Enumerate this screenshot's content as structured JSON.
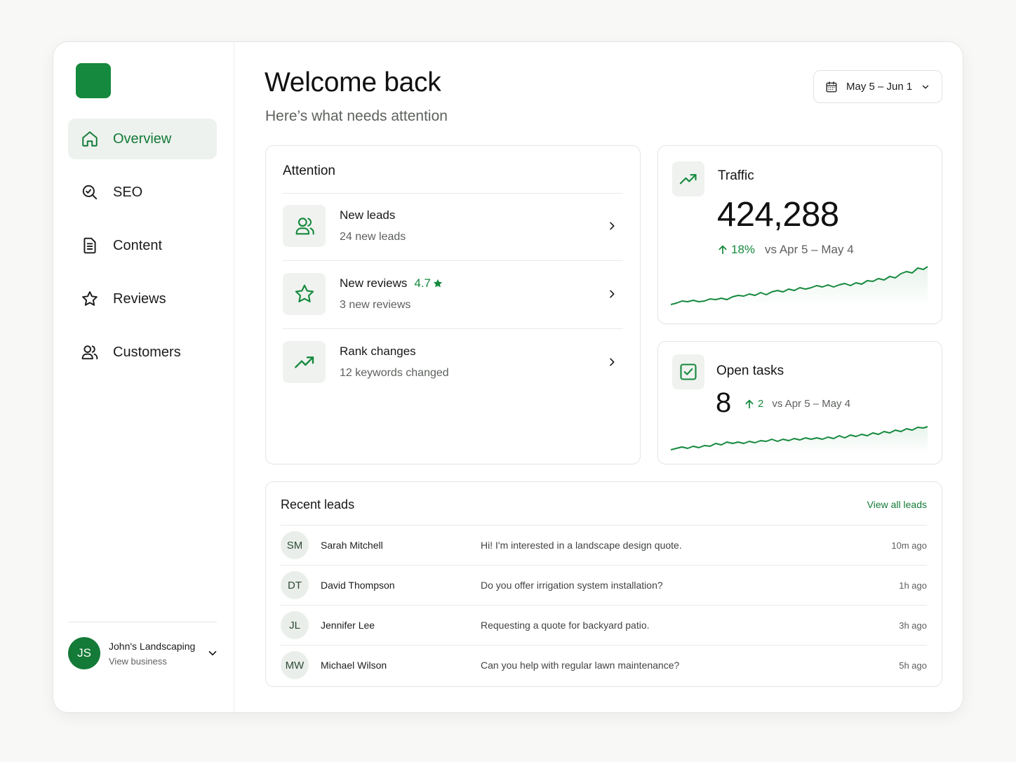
{
  "colors": {
    "accent": "#15893d",
    "accent_dark": "#137a37",
    "active_bg": "#eef2ee",
    "icon_bg": "#eff2ef"
  },
  "sidebar": {
    "logo_icon": "brand-square",
    "items": [
      {
        "label": "Overview",
        "icon": "home-icon",
        "active": true
      },
      {
        "label": "SEO",
        "icon": "search-icon",
        "active": false
      },
      {
        "label": "Content",
        "icon": "document-icon",
        "active": false
      },
      {
        "label": "Reviews",
        "icon": "star-icon",
        "active": false
      },
      {
        "label": "Customers",
        "icon": "users-icon",
        "active": false
      }
    ],
    "business": {
      "initials": "JS",
      "name": "John's Landscaping",
      "link": "View business"
    }
  },
  "header": {
    "title": "Welcome back",
    "subtitle": "Here’s what needs attention",
    "date_range": "May 5 – Jun 1"
  },
  "attention": {
    "title": "Attention",
    "items": [
      {
        "title": "New leads",
        "subtitle": "24 new leads",
        "icon": "users-icon"
      },
      {
        "title": "New reviews",
        "rating": "4.7",
        "subtitle": "3 new reviews",
        "icon": "star-icon"
      },
      {
        "title": "Rank changes",
        "subtitle": "12 keywords changed",
        "icon": "trending-up-icon"
      }
    ]
  },
  "traffic": {
    "title": "Traffic",
    "value": "424,288",
    "change": "18%",
    "comparison": "vs Apr 5 – May 4",
    "icon": "trending-up-icon"
  },
  "tasks": {
    "title": "Open tasks",
    "value": "8",
    "change": "2",
    "comparison": "vs Apr 5 – May 4",
    "icon": "checkbox-icon"
  },
  "recent_leads": {
    "title": "Recent leads",
    "view_all": "View all leads",
    "rows": [
      {
        "initials": "SM",
        "name": "Sarah Mitchell",
        "message": "Hi! I'm interested in a landscape design quote.",
        "time": "10m ago"
      },
      {
        "initials": "DT",
        "name": "David Thompson",
        "message": "Do you offer irrigation system installation?",
        "time": "1h ago"
      },
      {
        "initials": "JL",
        "name": "Jennifer Lee",
        "message": "Requesting a quote for backyard patio.",
        "time": "3h ago"
      },
      {
        "initials": "MW",
        "name": "Michael Wilson",
        "message": "Can you help with regular lawn maintenance?",
        "time": "5h ago"
      }
    ]
  }
}
